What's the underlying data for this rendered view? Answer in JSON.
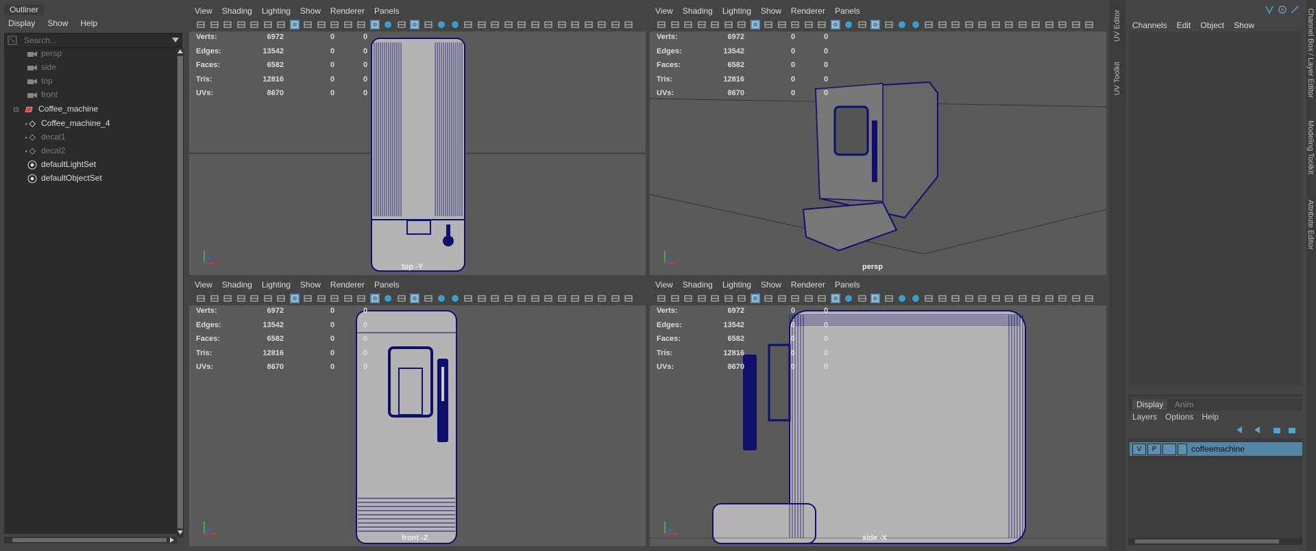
{
  "outliner": {
    "tab": "Outliner",
    "menu": [
      "Display",
      "Show",
      "Help"
    ],
    "search_placeholder": "Search...",
    "items": [
      {
        "label": "persp",
        "state": "dim"
      },
      {
        "label": "side",
        "state": "dim"
      },
      {
        "label": "top",
        "state": "dim"
      },
      {
        "label": "front",
        "state": "dim"
      },
      {
        "label": "Coffee_machine",
        "state": "bright"
      },
      {
        "label": "Coffee_machine_4",
        "state": "bright"
      },
      {
        "label": "decal1",
        "state": "dim"
      },
      {
        "label": "decal2",
        "state": "dim"
      },
      {
        "label": "defaultLightSet",
        "state": "bright"
      },
      {
        "label": "defaultObjectSet",
        "state": "bright"
      }
    ]
  },
  "viewport_menu": [
    "View",
    "Shading",
    "Lighting",
    "Show",
    "Renderer",
    "Panels"
  ],
  "hud": {
    "rows": [
      {
        "label": "Verts:",
        "value": "6972",
        "a": "0",
        "b": "0"
      },
      {
        "label": "Edges:",
        "value": "13542",
        "a": "0",
        "b": "0"
      },
      {
        "label": "Faces:",
        "value": "6582",
        "a": "0",
        "b": "0"
      },
      {
        "label": "Tris:",
        "value": "12816",
        "a": "0",
        "b": "0"
      },
      {
        "label": "UVs:",
        "value": "8670",
        "a": "0",
        "b": "0"
      }
    ]
  },
  "viewports": [
    {
      "name": "top",
      "camera_label": "top -Y"
    },
    {
      "name": "persp",
      "camera_label": "persp"
    },
    {
      "name": "front",
      "camera_label": "front -Z"
    },
    {
      "name": "side",
      "camera_label": "side -X"
    }
  ],
  "side_tabs": [
    "UV Editor",
    "UV Toolkit"
  ],
  "right_tabs": [
    "Channel Box / Layer Editor",
    "Modeling Toolkit",
    "Attribute Editor"
  ],
  "channelbox": {
    "menu": [
      "Channels",
      "Edit",
      "Object",
      "Show"
    ]
  },
  "layer_editor": {
    "tabs": [
      "Display",
      "Anim"
    ],
    "menu": [
      "Layers",
      "Options",
      "Help"
    ],
    "layer": {
      "v": "V",
      "p": "P",
      "name": "coffeemachine"
    }
  },
  "colors": {
    "viewport_bg": "#5a5a5a",
    "wire": "#0f0f6e",
    "surface": "#b4b4b4",
    "selected_layer": "#5285a6"
  }
}
